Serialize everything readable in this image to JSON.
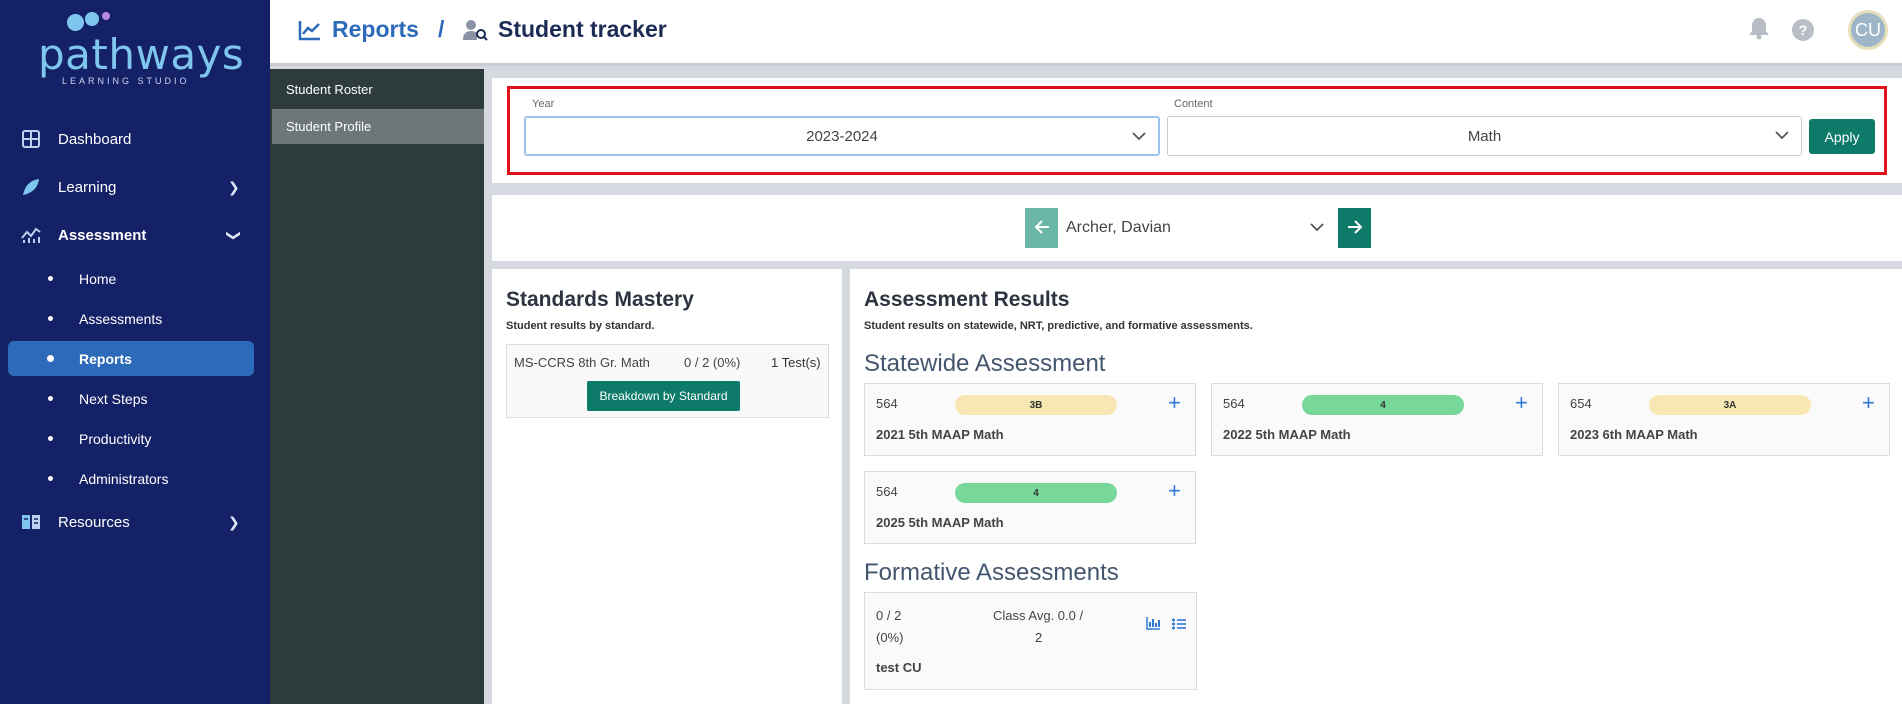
{
  "logo": {
    "word": "pathways",
    "sub": "LEARNING STUDIO"
  },
  "colors": {
    "nav_bg": "#152167",
    "accent_blue": "#2d6ab9",
    "teal": "#0d7a6a",
    "pill_yellow": "#f7e8b3",
    "pill_green": "#77d89a",
    "highlight_red": "#e0121b"
  },
  "nav": {
    "dashboard": "Dashboard",
    "learning": "Learning",
    "assessment": "Assessment",
    "sub": [
      "Home",
      "Assessments",
      "Reports",
      "Next Steps",
      "Productivity",
      "Administrators"
    ],
    "resources": "Resources"
  },
  "subnav": [
    "Student Roster",
    "Student Profile"
  ],
  "header": {
    "reports": "Reports",
    "sep": "/",
    "tracker": "Student tracker",
    "avatar": "CU"
  },
  "filters": {
    "year_label": "Year",
    "year_value": "2023-2024",
    "content_label": "Content",
    "content_value": "Math",
    "apply": "Apply"
  },
  "student": {
    "name": "Archer, Davian"
  },
  "mastery": {
    "title": "Standards Mastery",
    "subtitle": "Student results by standard.",
    "standard": "MS-CCRS 8th Gr. Math",
    "score": "0 / 2 (0%)",
    "tests": "1 Test(s)",
    "button": "Breakdown by Standard"
  },
  "results": {
    "title": "Assessment Results",
    "subtitle": "Student results on statewide, NRT, predictive, and formative assessments.",
    "statewide_title": "Statewide Assessment",
    "statewide": [
      {
        "score": "564",
        "level": "3B",
        "name": "2021 5th MAAP Math"
      },
      {
        "score": "564",
        "level": "4",
        "name": "2022 5th MAAP Math"
      },
      {
        "score": "654",
        "level": "3A",
        "name": "2023 6th MAAP Math"
      },
      {
        "score": "564",
        "level": "4",
        "name": "2025 5th MAAP Math"
      }
    ],
    "formative_title": "Formative Assessments",
    "formative": {
      "score_line1": "0 / 2",
      "score_line2": "(0%)",
      "avg_line1": "Class Avg. 0.0 /",
      "avg_line2": "2",
      "name": "test CU"
    }
  }
}
